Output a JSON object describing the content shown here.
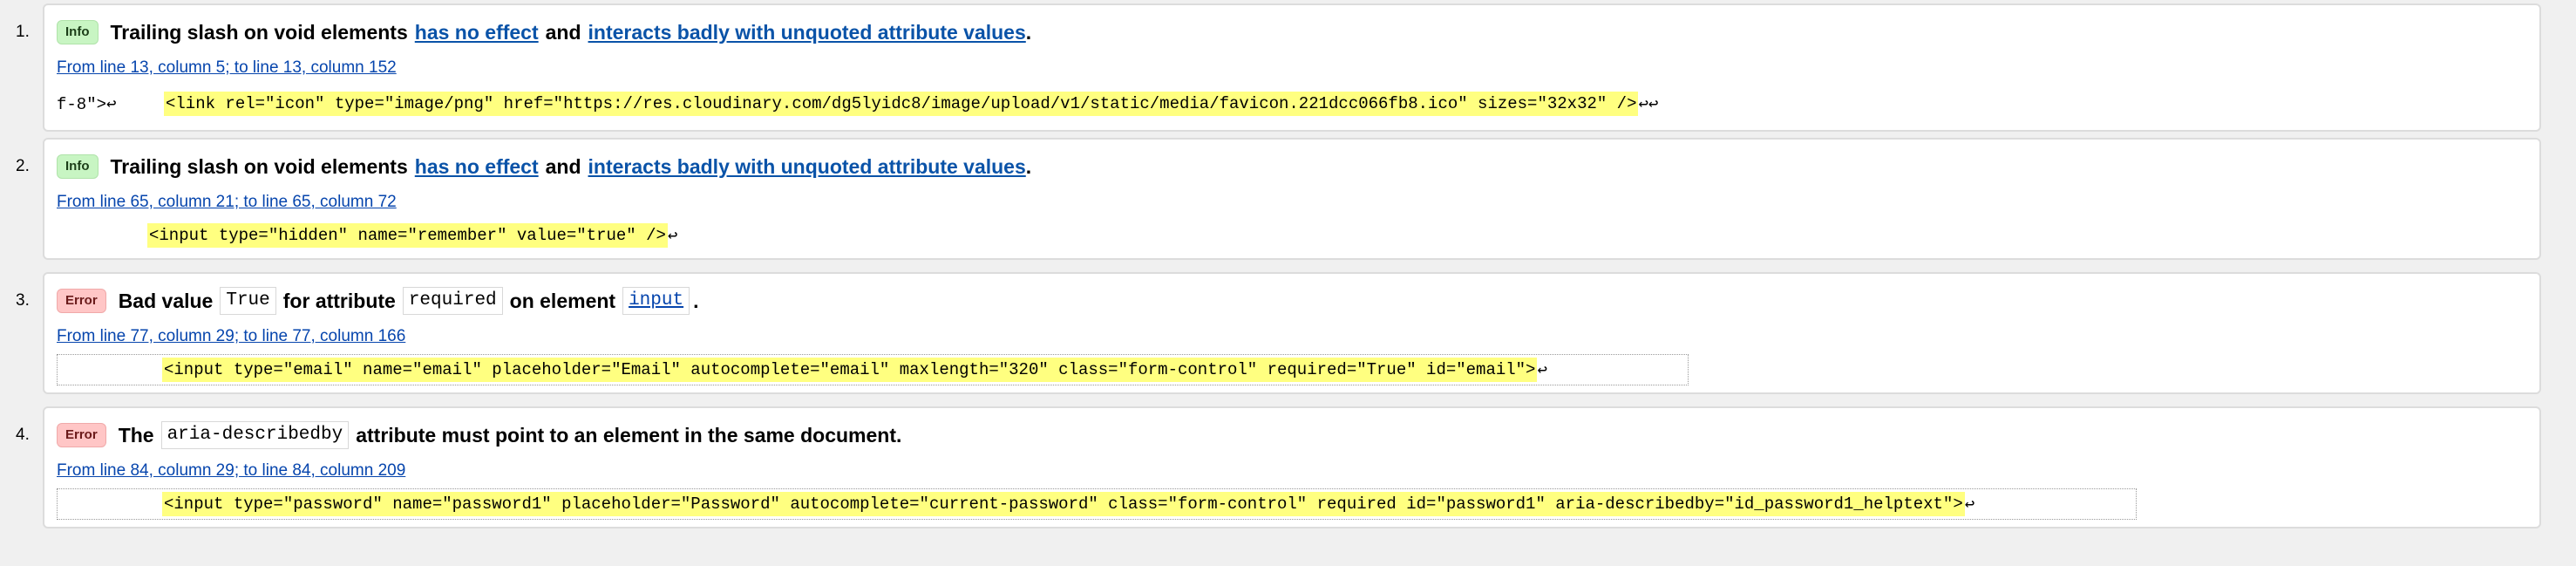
{
  "results": [
    {
      "number": "1.",
      "badge": "Info",
      "badge_type": "info",
      "title_parts": [
        "Trailing slash on void elements",
        "has no effect",
        "and",
        "interacts badly with unquoted attribute values",
        "."
      ],
      "location": "From line 13, column 5; to line 13, column 152",
      "extract_pre": "f-8\">↩",
      "extract_highlight": "<link rel=\"icon\" type=\"image/png\" href=\"https://res.cloudinary.com/dg5lyidc8/image/upload/v1/static/media/favicon.221dcc066fb8.ico\" sizes=\"32x32\" />",
      "extract_post": "↩↩"
    },
    {
      "number": "2.",
      "badge": "Info",
      "badge_type": "info",
      "title_parts": [
        "Trailing slash on void elements",
        "has no effect",
        "and",
        "interacts badly with unquoted attribute values",
        "."
      ],
      "location": "From line 65, column 21; to line 65, column 72",
      "extract_pre": "",
      "extract_highlight": "<input type=\"hidden\" name=\"remember\" value=\"true\" />",
      "extract_post": "↩"
    },
    {
      "number": "3.",
      "badge": "Error",
      "badge_type": "error",
      "title_parts": [
        "Bad value",
        "True",
        "for attribute",
        "required",
        "on element",
        "input",
        "."
      ],
      "location": "From line 77, column 29; to line 77, column 166",
      "extract_pre": "",
      "extract_highlight": "<input type=\"email\" name=\"email\" placeholder=\"Email\" autocomplete=\"email\" maxlength=\"320\" class=\"form-control\" required=\"True\" id=\"email\">",
      "extract_post": "↩"
    },
    {
      "number": "4.",
      "badge": "Error",
      "badge_type": "error",
      "title_parts": [
        "The",
        "aria-describedby",
        "attribute must point to an element in the same document",
        "."
      ],
      "location": "From line 84, column 29; to line 84, column 209",
      "extract_pre": "",
      "extract_highlight": "<input type=\"password\" name=\"password1\" placeholder=\"Password\" autocomplete=\"current-password\" class=\"form-control\" required id=\"password1\" aria-describedby=\"id_password1_helptext\">",
      "extract_post": "↩"
    }
  ],
  "colors": {
    "info_badge": "#c8f5c3",
    "error_badge": "#ffc6c6",
    "highlight": "#ffff80",
    "link": "#0645ad"
  }
}
